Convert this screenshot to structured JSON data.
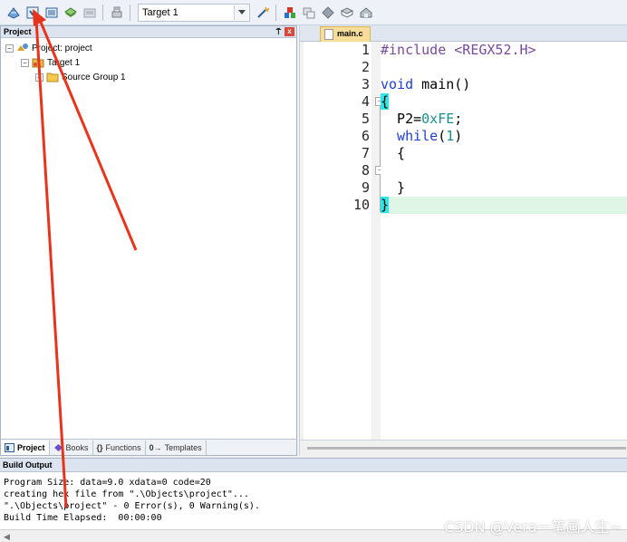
{
  "toolbar": {
    "target_select": "Target 1"
  },
  "project_pane": {
    "title": "Project",
    "pin_glyph": "⍑",
    "close_glyph": "x",
    "tree": {
      "project_label": "Project: project",
      "target_label": "Target 1",
      "group_label": "Source Group 1"
    },
    "tabs": [
      "Project",
      "Books",
      "Functions",
      "Templates"
    ],
    "tab_prefixes": [
      "",
      "",
      "{}",
      "0→"
    ]
  },
  "editor": {
    "tab_label": "main.c",
    "line_numbers": [
      "1",
      "2",
      "3",
      "4",
      "5",
      "6",
      "7",
      "8",
      "9",
      "10"
    ],
    "code": {
      "l1_directive": "#include",
      "l1_header": " <REGX52.H>",
      "l3_void": "void",
      "l3_main": " main()",
      "l4_brace": "{",
      "l5_lhs": "  P2=",
      "l5_hex": "0xFE",
      "l5_semi": ";",
      "l6_while": "  while",
      "l6_open": "(",
      "l6_one": "1",
      "l6_close": ")",
      "l7_brace": "  {",
      "l9_brace": "  }",
      "l10_brace": "}"
    },
    "fold_glyphs": {
      "l4": "−",
      "l7": "−"
    }
  },
  "build_output": {
    "title": "Build Output",
    "lines": [
      "Program Size: data=9.0 xdata=0 code=20",
      "creating hex file from \".\\Objects\\project\"...",
      "\".\\Objects\\project\" - 0 Error(s), 0 Warning(s).",
      "Build Time Elapsed:  00:00:00"
    ],
    "scroll_left_glyph": "◀"
  },
  "watermark": "CSDN @Vera一笔画人生~",
  "colors": {
    "annotation_arrow": "#e8341c",
    "brace_highlight": "#2ee6e6",
    "current_line": "#dff6e6",
    "keyword": "#1f3fd1",
    "preprocessor": "#7a4a9e",
    "number": "#1a8f8f"
  }
}
